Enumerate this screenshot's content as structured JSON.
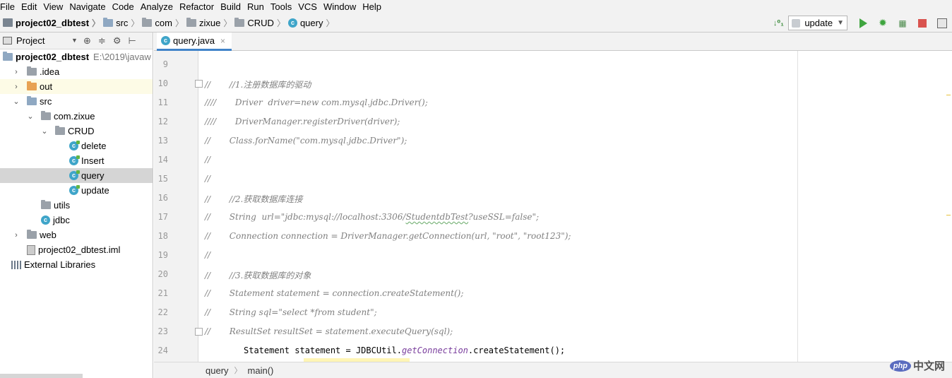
{
  "menu": [
    "File",
    "Edit",
    "View",
    "Navigate",
    "Code",
    "Analyze",
    "Refactor",
    "Build",
    "Run",
    "Tools",
    "VCS",
    "Window",
    "Help"
  ],
  "navbar": {
    "crumbs": [
      "project02_dbtest",
      "src",
      "com",
      "zixue",
      "CRUD",
      "query"
    ],
    "run_config": "update"
  },
  "project_panel": {
    "title": "Project",
    "tree": [
      {
        "label": "project02_dbtest",
        "path": "E:\\2019\\javaw",
        "icon": "project-folder-icon",
        "expanded": true
      },
      {
        "label": ".idea",
        "icon": "folder-icon",
        "expanded": false
      },
      {
        "label": "out",
        "icon": "excluded-folder-icon",
        "expanded": false
      },
      {
        "label": "src",
        "icon": "source-folder-icon",
        "expanded": true
      },
      {
        "label": "com.zixue",
        "icon": "package-icon",
        "expanded": true
      },
      {
        "label": "CRUD",
        "icon": "package-icon",
        "expanded": true
      },
      {
        "label": "delete",
        "icon": "class-icon"
      },
      {
        "label": "Insert",
        "icon": "class-icon"
      },
      {
        "label": "query",
        "icon": "class-icon"
      },
      {
        "label": "update",
        "icon": "class-icon"
      },
      {
        "label": "utils",
        "icon": "package-icon",
        "expanded": false
      },
      {
        "label": "jdbc",
        "icon": "class-icon"
      },
      {
        "label": "web",
        "icon": "folder-icon",
        "expanded": false
      },
      {
        "label": "project02_dbtest.iml",
        "icon": "iml-file-icon"
      },
      {
        "label": "External Libraries",
        "icon": "libraries-icon",
        "expanded": false
      }
    ]
  },
  "editor": {
    "tab": "query.java",
    "tab_close": "×",
    "lines": [
      {
        "num": "9",
        "text": ""
      },
      {
        "num": "10",
        "text": "//       //1.注册数据库的驱动"
      },
      {
        "num": "11",
        "text": "////       Driver  driver=new com.mysql.jdbc.Driver();"
      },
      {
        "num": "12",
        "text": "////       DriverManager.registerDriver(driver);"
      },
      {
        "num": "13",
        "text": "//       Class.forName(\"com.mysql.jdbc.Driver\");"
      },
      {
        "num": "14",
        "text": "//"
      },
      {
        "num": "15",
        "text": "//"
      },
      {
        "num": "16",
        "text": "//       //2.获取数据库连接"
      },
      {
        "num": "17",
        "text": "//       String  url=\"jdbc:mysql://localhost:3306/StudentdbTest?useSSL=false\";"
      },
      {
        "num": "18",
        "text": "//       Connection connection = DriverManager.getConnection(url, \"root\", \"root123\");"
      },
      {
        "num": "19",
        "text": "//"
      },
      {
        "num": "20",
        "text": "//       //3.获取数据库的对象"
      },
      {
        "num": "21",
        "text": "//       Statement statement = connection.createStatement();"
      },
      {
        "num": "22",
        "text": "//       String sql=\"select *from student\";"
      },
      {
        "num": "23",
        "text": "//       ResultSet resultSet = statement.executeQuery(sql);"
      },
      {
        "num": "24",
        "text": "        Statement statement = JDBCUtil.getConnection.createStatement();"
      }
    ],
    "line24_parts": [
      "        Statement statement = JDBCUtil.",
      "getConnection",
      ".createStatement();"
    ]
  },
  "breadcrumb": [
    "query",
    "main()"
  ],
  "watermark": {
    "badge": "php",
    "text": "中文网"
  }
}
